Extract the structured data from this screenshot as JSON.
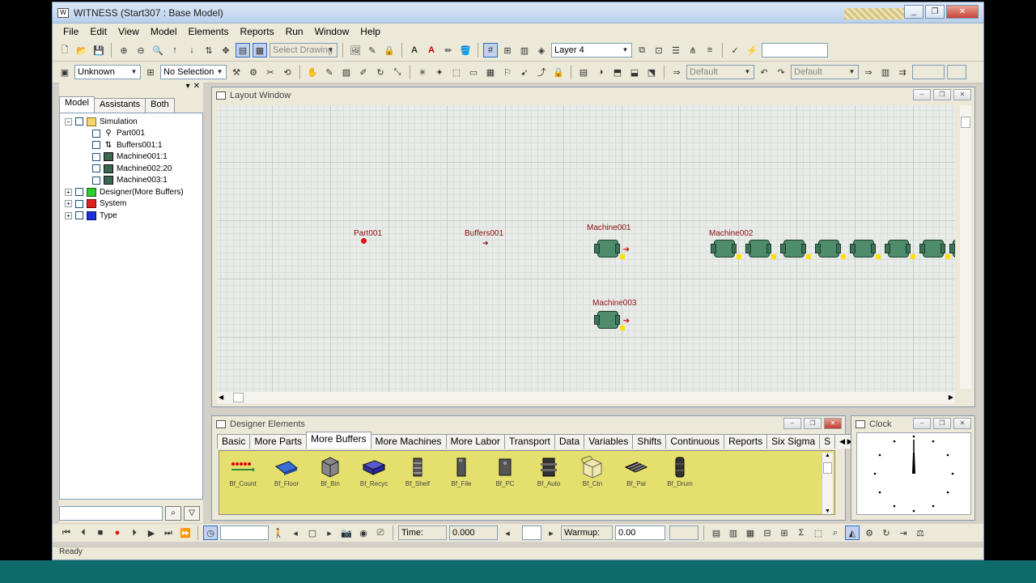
{
  "window": {
    "title": "WITNESS (Start307 : Base Model)"
  },
  "menu": [
    "File",
    "Edit",
    "View",
    "Model",
    "Elements",
    "Reports",
    "Run",
    "Window",
    "Help"
  ],
  "toolbar1": {
    "select_drawing": "Select Drawing",
    "layer": "Layer 4"
  },
  "toolbar2": {
    "unknown": "Unknown",
    "selection": "No Selection",
    "default1": "Default",
    "default2": "Default"
  },
  "tree_panel": {
    "tabs": [
      "Model",
      "Assistants",
      "Both"
    ],
    "items": [
      {
        "label": "Simulation",
        "level": 0
      },
      {
        "label": "Part001",
        "level": 1
      },
      {
        "label": "Buffers001:1",
        "level": 1
      },
      {
        "label": "Machine001:1",
        "level": 1
      },
      {
        "label": "Machine002:20",
        "level": 1
      },
      {
        "label": "Machine003:1",
        "level": 1
      },
      {
        "label": "Designer(More Buffers)",
        "level": 0
      },
      {
        "label": "System",
        "level": 0
      },
      {
        "label": "Type",
        "level": 0
      }
    ]
  },
  "layout_window": {
    "title": "Layout Window",
    "labels": {
      "part": "Part001",
      "buffers": "Buffers001",
      "machine1": "Machine001",
      "machine2": "Machine002",
      "machine3": "Machine003"
    }
  },
  "designer": {
    "title": "Designer Elements",
    "tabs": [
      "Basic",
      "More Parts",
      "More Buffers",
      "More Machines",
      "More Labor",
      "Transport",
      "Data",
      "Variables",
      "Shifts",
      "Continuous",
      "Reports",
      "Six Sigma",
      "S"
    ],
    "items": [
      "Bf_Count",
      "Bf_Floor",
      "Bf_Bin",
      "Bf_Recyc",
      "Bf_Shelf",
      "Bf_File",
      "Bf_PC",
      "Bf_Auto",
      "Bf_Ctn",
      "Bf_Pal",
      "Bf_Drum"
    ]
  },
  "clock": {
    "title": "Clock"
  },
  "runbar": {
    "time_label": "Time:",
    "time_value": "0.000",
    "warmup_label": "Warmup:",
    "warmup_value": "0.00"
  },
  "status": {
    "text": "Ready"
  }
}
